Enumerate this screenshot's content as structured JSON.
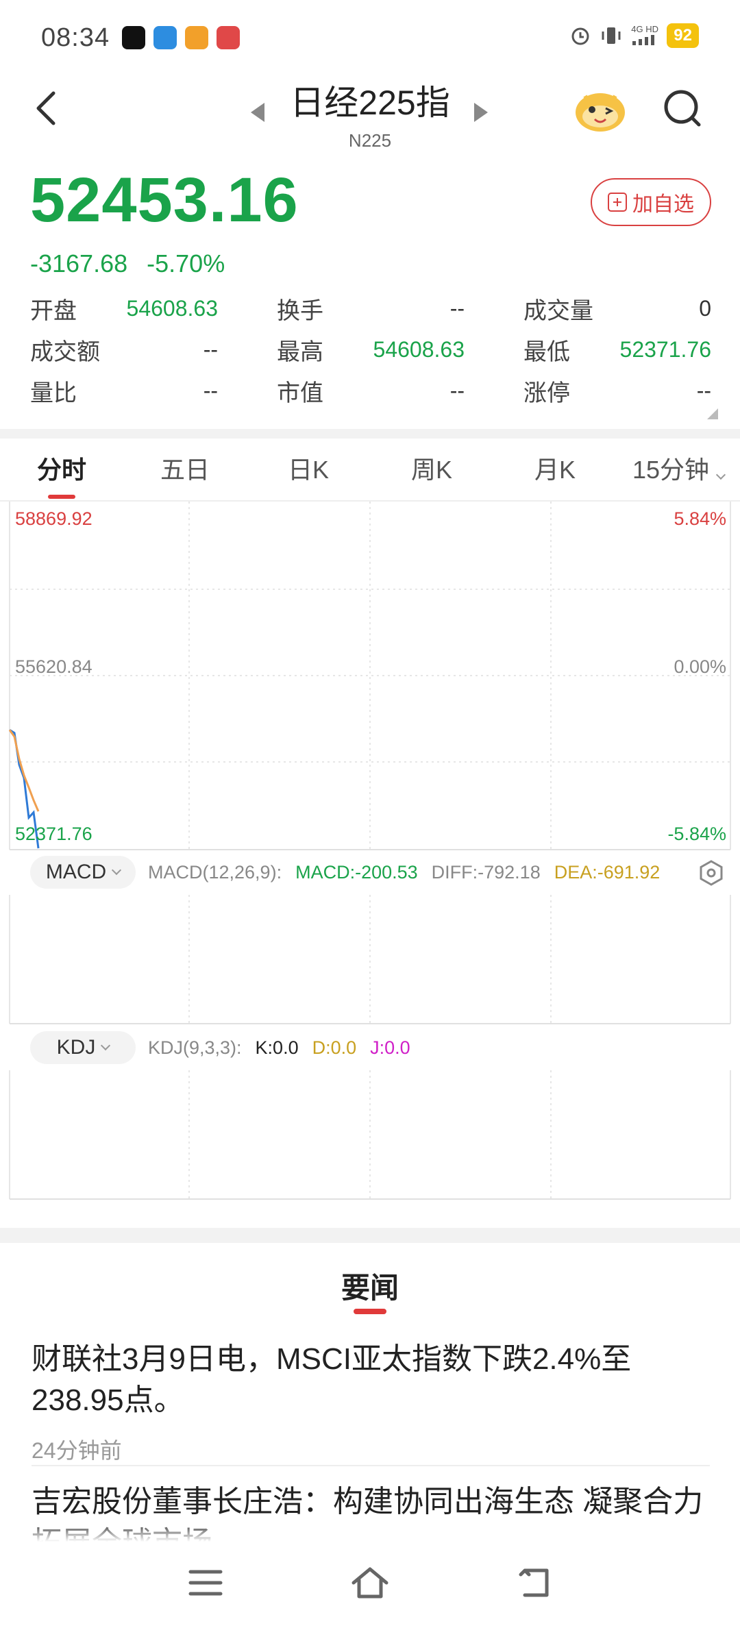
{
  "status_bar": {
    "time": "08:34",
    "network": "4G HD",
    "battery": "92",
    "app_icons": [
      "tiktok-icon",
      "app-icon-blue",
      "app-icon-game",
      "app-icon-red"
    ],
    "colors": {
      "battery": "#f4c20d"
    }
  },
  "header": {
    "title": "日经225指",
    "subtitle": "N225"
  },
  "quote": {
    "price": "52453.16",
    "change": "-3167.68",
    "change_pct": "-5.70%",
    "add_watchlist_label": "加自选",
    "colors": {
      "down": "#1aa34a",
      "up": "#d94040"
    }
  },
  "stats": {
    "rows": [
      [
        {
          "label": "开盘",
          "value": "54608.63"
        },
        {
          "label": "换手",
          "value": "--"
        },
        {
          "label": "成交量",
          "value": "0"
        }
      ],
      [
        {
          "label": "成交额",
          "value": "--"
        },
        {
          "label": "最高",
          "value": "54608.63"
        },
        {
          "label": "最低",
          "value": "52371.76"
        }
      ],
      [
        {
          "label": "量比",
          "value": "--"
        },
        {
          "label": "市值",
          "value": "--"
        },
        {
          "label": "涨停",
          "value": "--"
        }
      ]
    ]
  },
  "tabs": [
    "分时",
    "五日",
    "日K",
    "周K",
    "月K",
    "15分钟"
  ],
  "chart": {
    "y_top_left": "58869.92",
    "y_mid_left": "55620.84",
    "y_bot_left": "52371.76",
    "y_top_right": "5.84%",
    "y_mid_right": "0.00%",
    "y_bot_right": "-5.84%"
  },
  "chart_data": {
    "type": "line",
    "ylim": [
      52371.76,
      58869.92
    ],
    "series": [
      {
        "color": "#2f7ad6",
        "values": [
          54608.63,
          54550.0,
          53950.0,
          53700.0,
          52950.0,
          53050.0,
          52371.76
        ]
      },
      {
        "color": "#f0a050",
        "values": [
          54608.63,
          54480.0,
          54060.0,
          53750.0,
          53520.0,
          53280.0,
          53070.0
        ]
      }
    ]
  },
  "macd": {
    "selector": "MACD",
    "params": "MACD(12,26,9):",
    "macd": "MACD:-200.53",
    "diff": "DIFF:-792.18",
    "dea": "DEA:-691.92"
  },
  "kdj": {
    "selector": "KDJ",
    "params": "KDJ(9,3,3):",
    "k": "K:0.0",
    "d": "D:0.0",
    "j": "J:0.0"
  },
  "news": {
    "section_title": "要闻",
    "items": [
      {
        "text": "财联社3月9日电，MSCI亚太指数下跌2.4%至238.95点。",
        "time": "24分钟前"
      },
      {
        "text": "吉宏股份董事长庄浩：构建协同出海生态 凝聚合力拓展全球市场",
        "time": ""
      }
    ]
  }
}
